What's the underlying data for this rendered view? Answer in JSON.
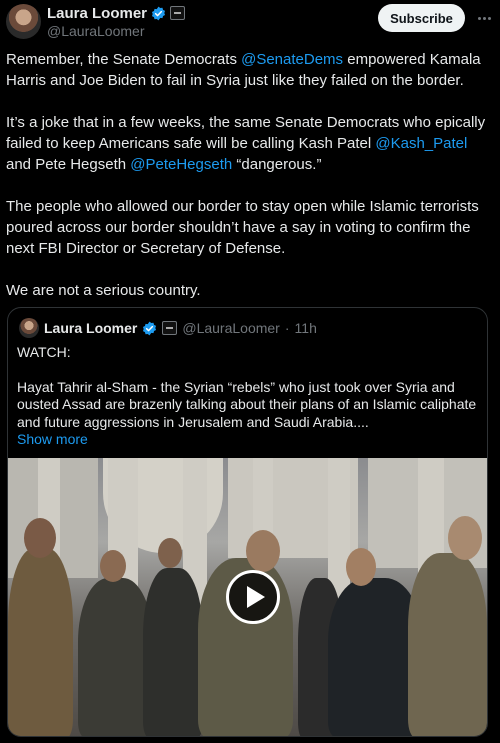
{
  "post": {
    "author": {
      "name": "Laura Loomer",
      "handle": "@LauraLoomer"
    },
    "subscribe_label": "Subscribe",
    "paragraphs": [
      {
        "segments": [
          {
            "text": "Remember, the Senate Democrats "
          },
          {
            "text": "@SenateDems",
            "mention": true
          },
          {
            "text": " empowered Kamala Harris and Joe Biden to fail in Syria just like they failed on the border."
          }
        ]
      },
      {
        "segments": [
          {
            "text": "It’s a joke that in a few weeks, the same Senate Democrats who epically failed to keep Americans safe will be calling Kash Patel "
          },
          {
            "text": "@Kash_Patel",
            "mention": true
          },
          {
            "text": " and Pete Hegseth "
          },
          {
            "text": "@PeteHegseth",
            "mention": true
          },
          {
            "text": " “dangerous.”"
          }
        ]
      },
      {
        "segments": [
          {
            "text": "The people who allowed our border to stay open while Islamic terrorists poured across our border shouldn’t have a say in voting to confirm the next FBI Director or Secretary of Defense."
          }
        ]
      },
      {
        "segments": [
          {
            "text": "We are not a serious country."
          }
        ]
      }
    ]
  },
  "quote": {
    "name": "Laura Loomer",
    "handle": "@LauraLoomer",
    "separator": "·",
    "time": "11h",
    "watch": "WATCH:",
    "text": "Hayat Tahrir al-Sham - the Syrian “rebels” who just took over Syria and ousted Assad are brazenly talking about their plans of an Islamic caliphate and future aggressions in Jerusalem and Saudi Arabia....",
    "show_more": "Show more"
  },
  "icons": {
    "verified": "verified-badge-icon",
    "affiliation": "affiliation-badge-icon",
    "more": "more-options-icon",
    "play": "play-icon"
  },
  "colors": {
    "background": "#000000",
    "text": "#e7e9ea",
    "muted": "#71767b",
    "link": "#1d9bf0",
    "border": "#2f3336"
  }
}
